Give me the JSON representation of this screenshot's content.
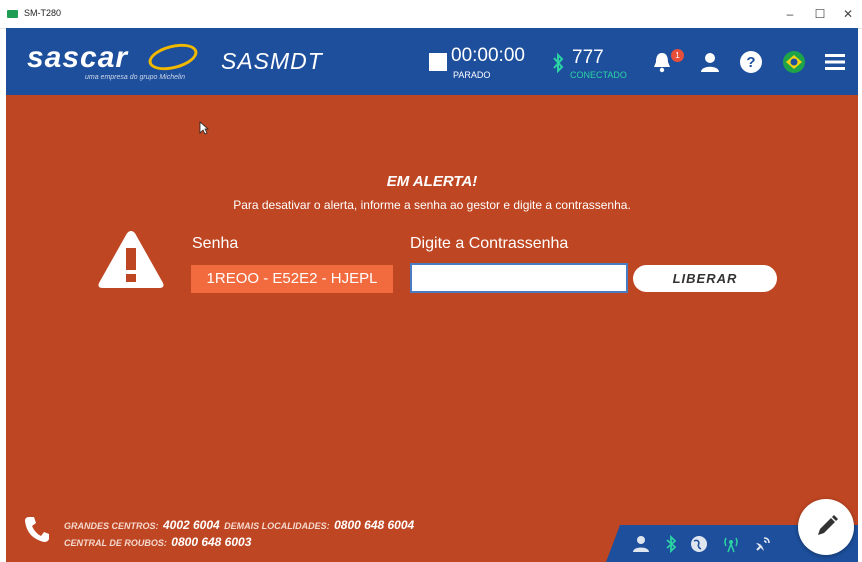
{
  "window": {
    "title": "SM-T280",
    "minimize": "–",
    "maximize": "☐",
    "close": "✕"
  },
  "header": {
    "logo_text": "sascar",
    "logo_subtitle": "uma empresa do grupo Michelin",
    "app_name": "SASMDT",
    "timer": {
      "value": "00:00:00",
      "status": "PARADO"
    },
    "connection": {
      "value": "777",
      "status": "CONECTADO"
    },
    "notifications_count": "1",
    "colors": {
      "bar": "#1d4f9c",
      "connected": "#2bd3a4"
    }
  },
  "alert": {
    "title": "EM ALERTA!",
    "message": "Para desativar o alerta, informe a senha ao gestor e digite a contrassenha.",
    "senha_label": "Senha",
    "senha_value": "1REOO - E52E2 - HJEPL",
    "contrassenha_label": "Digite a  Contrassenha",
    "contrassenha_value": "",
    "liberar_label": "LIBERAR",
    "colors": {
      "background": "#bf4622",
      "senha_box": "#f26b3f"
    }
  },
  "footer": {
    "grandes_centros_label": "GRANDES CENTROS:",
    "grandes_centros_number": "4002 6004",
    "demais_label": "DEMAIS LOCALIDADES:",
    "demais_number": "0800 648 6004",
    "roubos_label": "CENTRAL DE ROUBOS:",
    "roubos_number": "0800 648 6003",
    "status_icons": [
      "user-icon",
      "bluetooth-icon",
      "globe-icon",
      "antenna-icon",
      "satellite-icon"
    ]
  }
}
